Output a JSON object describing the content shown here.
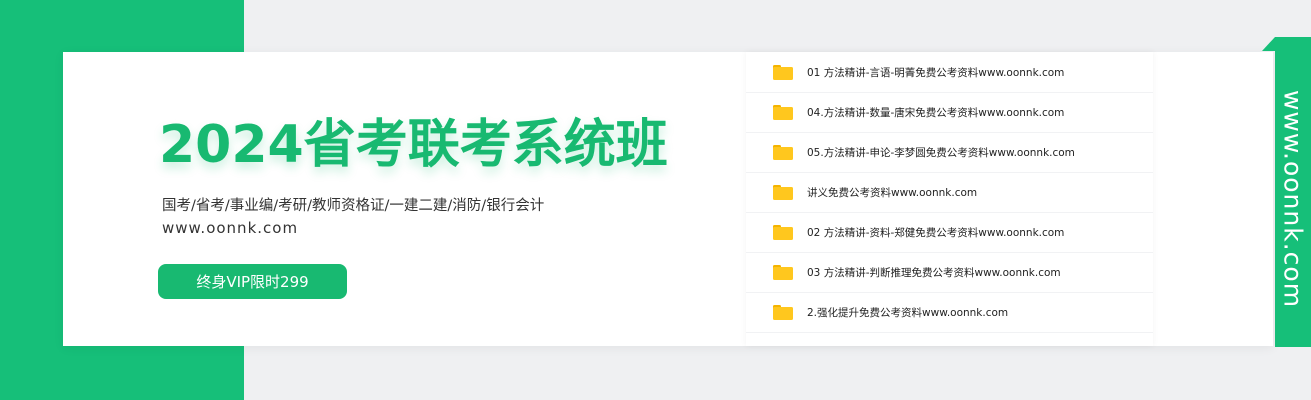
{
  "banner": {
    "title": "2024省考联考系统班",
    "subtitle": "国考/省考/事业编/考研/教师资格证/一建二建/消防/银行会计",
    "url": "www.oonnk.com",
    "cta_label": "终身VIP限时299"
  },
  "files": [
    {
      "name": "01 方法精讲-言语-明菁免费公考资料www.oonnk.com",
      "icon": "folder-icon"
    },
    {
      "name": "04.方法精讲-数量-唐宋免费公考资料www.oonnk.com",
      "icon": "folder-icon"
    },
    {
      "name": "05.方法精讲-申论-李梦圆免费公考资料www.oonnk.com",
      "icon": "folder-icon"
    },
    {
      "name": "讲义免费公考资料www.oonnk.com",
      "icon": "folder-icon"
    },
    {
      "name": "02 方法精讲-资料-郑健免费公考资料www.oonnk.com",
      "icon": "folder-icon"
    },
    {
      "name": "03 方法精讲-判断推理免费公考资料www.oonnk.com",
      "icon": "folder-icon"
    },
    {
      "name": "2.强化提升免费公考资料www.oonnk.com",
      "icon": "folder-icon"
    }
  ],
  "side": {
    "vertical_url": "www.oonnk.com"
  },
  "colors": {
    "brand_green": "#16bf79",
    "folder_yellow": "#ffc71e"
  }
}
